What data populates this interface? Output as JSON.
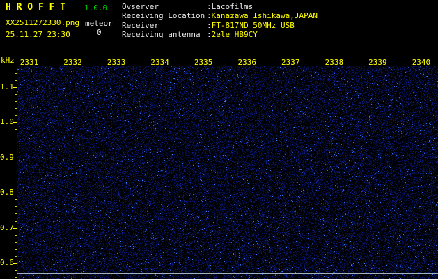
{
  "app": {
    "title": "H R O F F T",
    "version": "1.0.0",
    "filename": "XX2511272330.png",
    "mode_label": "meteor",
    "meteor_count": "0",
    "timestamp": "25.11.27 23:30"
  },
  "info": {
    "separator": ": ",
    "rows": [
      {
        "label": "Ovserver",
        "value": "Lacofilms",
        "value_color": "#e8e8e8"
      },
      {
        "label": "Receiving Location",
        "value": "Kanazawa Ishikawa,JAPAN",
        "value_color": "#ffff00"
      },
      {
        "label": "Receiver",
        "value": "FT-817ND 50MHz USB",
        "value_color": "#ffff00"
      },
      {
        "label": "Receiving antenna",
        "value": "2ele HB9CY",
        "value_color": "#ffff00"
      }
    ]
  },
  "axes": {
    "unit": "kHz",
    "time_labels": [
      "2331",
      "2332",
      "2333",
      "2334",
      "2335",
      "2336",
      "2337",
      "2338",
      "2339",
      "2340"
    ],
    "freq_labels": [
      "1.1",
      "1.0",
      "0.9",
      "0.8",
      "0.7",
      "0.6"
    ]
  },
  "colors": {
    "yellow": "#ffff00",
    "green": "#00cc00",
    "white": "#e8e8e8",
    "tick_yellow": "#d8d800",
    "noise_blue": "#2038c0",
    "background": "#000000"
  },
  "spectrogram": {
    "noise_density": 0.5,
    "bright_speck_rate": 0.025,
    "baseline_lines": [
      {
        "freq_khz": 0.57,
        "color": "#9fb3bb"
      },
      {
        "freq_khz": 0.558,
        "color": "#d2e2e4"
      }
    ]
  }
}
